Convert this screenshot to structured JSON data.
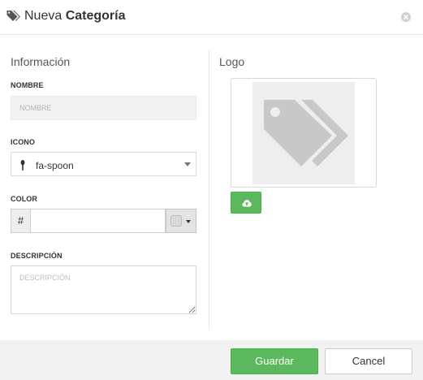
{
  "header": {
    "title_prefix": "Nueva",
    "title_main": "Categoría",
    "title_icon": "tags-icon",
    "close_icon": "close-icon"
  },
  "info_section": {
    "title": "Información",
    "nombre": {
      "label": "NOMBRE",
      "placeholder": "NOMBRE",
      "value": ""
    },
    "icono": {
      "label": "ICONO",
      "icon": "spoon-icon",
      "selected": "fa-spoon"
    },
    "color": {
      "label": "COLOR",
      "prefix": "#",
      "value": "",
      "swatch_color": "#d9d9d9"
    },
    "descripcion": {
      "label": "DESCRIPCIÓN",
      "placeholder": "DESCRIPCIÓN",
      "value": ""
    }
  },
  "logo_section": {
    "title": "Logo",
    "placeholder_icon": "tags-icon",
    "upload_icon": "cloud-upload-icon"
  },
  "footer": {
    "save_label": "Guardar",
    "cancel_label": "Cancel"
  },
  "colors": {
    "accent_green": "#5cb85c",
    "footer_bg": "#f2f2f2",
    "placeholder_gray": "#c8c8c8"
  }
}
